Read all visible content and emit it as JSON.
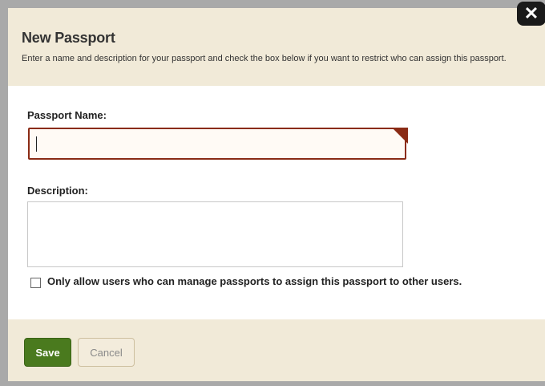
{
  "dialog": {
    "title": "New Passport",
    "description": "Enter a name and description for your passport and check the box below if you want to restrict who can assign this passport.",
    "close_label": "✕",
    "close_icon": "close-icon"
  },
  "form": {
    "name_label": "Passport Name:",
    "name_value": "",
    "description_label": "Description:",
    "description_value": "",
    "restrict_checkbox_label": "Only allow users who can manage passports to assign this passport to other users.",
    "restrict_checked": false
  },
  "footer": {
    "save_label": "Save",
    "cancel_label": "Cancel"
  },
  "colors": {
    "accent_border": "#8a2b15",
    "save_button": "#4a7a1e",
    "panel_background": "#f1ead8"
  }
}
